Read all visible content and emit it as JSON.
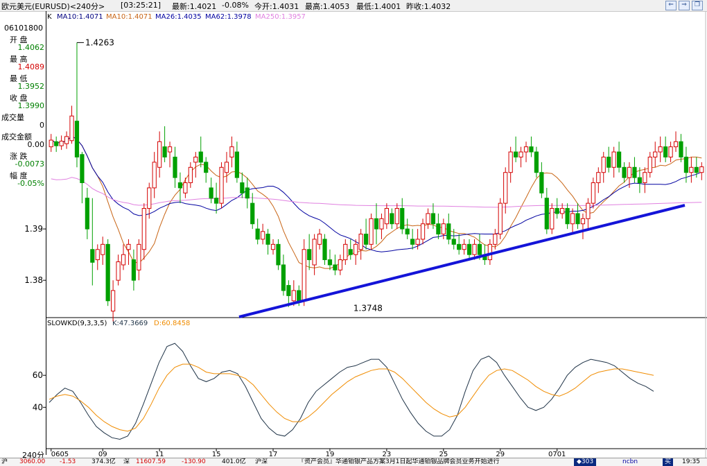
{
  "window": {
    "title": "欧元美元(EURUSD)<240分>",
    "time": "[03:25:21]",
    "latest": "最新:1.4021",
    "change_pct": "-0.08%",
    "open_today": "今开:1.4031",
    "high": "最高:1.4053",
    "low": "最低:1.4001",
    "prev_close": "昨收:1.4032"
  },
  "side_panel": {
    "date": "06101800",
    "open_label": "开  盘",
    "open_value": "1.4062",
    "high_label": "最  高",
    "high_value": "1.4089",
    "low_label": "最  低",
    "low_value": "1.3952",
    "close_label": "收  盘",
    "close_value": "1.3990",
    "volume_label": "成交量",
    "volume_value": "0",
    "amount_label": "成交金额",
    "amount_value": "0.00",
    "change_label": "涨  跌",
    "change_value": "-0.0073",
    "range_label": "幅  度",
    "range_value": "-0.05%",
    "period_label": "240分"
  },
  "colors": {
    "up": "#d40000",
    "down": "#00a000",
    "ma10": "#c86414",
    "ma26": "#0000a0",
    "ma250": "#e080e0",
    "trendline": "#1414d8",
    "k_line": "#1e3246",
    "d_line": "#f08c00",
    "label_text": "#000000",
    "value_text": "#008000",
    "high_text": "#d40000"
  },
  "legend": {
    "k": "K",
    "ma10a": "MA10:1.4071",
    "ma10b": "MA10:1.4071",
    "ma26": "MA26:1.4035",
    "ma62": "MA62:1.3978",
    "ma250": "MA250:1.3957",
    "slowkd": "SLOWKD(9,3,3,5)",
    "slowk": "K:47.3669",
    "slowd": "D:60.8458"
  },
  "chart_data": [
    {
      "type": "candlestick",
      "ylim": [
        1.373,
        1.43
      ],
      "y_ticks": [
        "1.39",
        "1.38"
      ],
      "y_tick_values": [
        1.39,
        1.38
      ],
      "annotations": [
        {
          "label": "1.4263",
          "x": 5,
          "value": 1.4263
        },
        {
          "label": "1.3748",
          "x": 65,
          "value": 1.3748
        }
      ],
      "candles": [
        [
          1.406,
          1.4085,
          1.405,
          1.4073
        ],
        [
          1.407,
          1.408,
          1.405,
          1.4062
        ],
        [
          1.4062,
          1.4082,
          1.4054,
          1.4071
        ],
        [
          1.4066,
          1.409,
          1.4056,
          1.408
        ],
        [
          1.4072,
          1.414,
          1.4066,
          1.412
        ],
        [
          1.411,
          1.4263,
          1.402,
          1.404
        ],
        [
          1.4045,
          1.405,
          1.395,
          1.399
        ],
        [
          1.396,
          1.398,
          1.388,
          1.39
        ],
        [
          1.386,
          1.396,
          1.379,
          1.3835
        ],
        [
          1.384,
          1.387,
          1.382,
          1.386
        ],
        [
          1.385,
          1.3885,
          1.383,
          1.387
        ],
        [
          1.387,
          1.388,
          1.375,
          1.376
        ],
        [
          1.374,
          1.38,
          1.372,
          1.378
        ],
        [
          1.38,
          1.385,
          1.379,
          1.3836
        ],
        [
          1.383,
          1.387,
          1.382,
          1.385
        ],
        [
          1.386,
          1.388,
          1.383,
          1.387
        ],
        [
          1.384,
          1.386,
          1.378,
          1.38
        ],
        [
          1.382,
          1.388,
          1.38,
          1.387
        ],
        [
          1.386,
          1.395,
          1.384,
          1.394
        ],
        [
          1.394,
          1.399,
          1.392,
          1.398
        ],
        [
          1.398,
          1.405,
          1.396,
          1.403
        ],
        [
          1.402,
          1.409,
          1.4,
          1.407
        ],
        [
          1.406,
          1.41,
          1.403,
          1.404
        ],
        [
          1.405,
          1.407,
          1.402,
          1.406
        ],
        [
          1.404,
          1.406,
          1.398,
          1.4
        ],
        [
          1.399,
          1.401,
          1.395,
          1.398
        ],
        [
          1.397,
          1.4,
          1.396,
          1.399
        ],
        [
          1.399,
          1.403,
          1.398,
          1.402
        ],
        [
          1.403,
          1.405,
          1.4,
          1.404
        ],
        [
          1.405,
          1.408,
          1.402,
          1.403
        ],
        [
          1.403,
          1.404,
          1.399,
          1.401
        ],
        [
          1.398,
          1.4,
          1.395,
          1.396
        ],
        [
          1.396,
          1.399,
          1.393,
          1.395
        ],
        [
          1.395,
          1.403,
          1.394,
          1.402
        ],
        [
          1.401,
          1.405,
          1.399,
          1.403
        ],
        [
          1.404,
          1.408,
          1.402,
          1.406
        ],
        [
          1.405,
          1.407,
          1.399,
          1.4
        ],
        [
          1.399,
          1.401,
          1.396,
          1.397
        ],
        [
          1.398,
          1.4,
          1.394,
          1.396
        ],
        [
          1.395,
          1.397,
          1.39,
          1.391
        ],
        [
          1.39,
          1.392,
          1.387,
          1.388
        ],
        [
          1.388,
          1.391,
          1.387,
          1.3895
        ],
        [
          1.389,
          1.39,
          1.385,
          1.387
        ],
        [
          1.386,
          1.388,
          1.385,
          1.387
        ],
        [
          1.387,
          1.388,
          1.382,
          1.383
        ],
        [
          1.383,
          1.385,
          1.377,
          1.378
        ],
        [
          1.379,
          1.38,
          1.3748,
          1.377
        ],
        [
          1.376,
          1.38,
          1.375,
          1.378
        ],
        [
          1.378,
          1.379,
          1.375,
          1.376
        ],
        [
          1.376,
          1.388,
          1.375,
          1.386
        ],
        [
          1.386,
          1.389,
          1.382,
          1.384
        ],
        [
          1.383,
          1.389,
          1.381,
          1.388
        ],
        [
          1.387,
          1.39,
          1.386,
          1.389
        ],
        [
          1.388,
          1.389,
          1.383,
          1.384
        ],
        [
          1.384,
          1.386,
          1.382,
          1.383
        ],
        [
          1.383,
          1.385,
          1.381,
          1.382
        ],
        [
          1.382,
          1.385,
          1.381,
          1.384
        ],
        [
          1.384,
          1.388,
          1.383,
          1.387
        ],
        [
          1.386,
          1.388,
          1.384,
          1.385
        ],
        [
          1.385,
          1.388,
          1.383,
          1.387
        ],
        [
          1.386,
          1.39,
          1.384,
          1.389
        ],
        [
          1.389,
          1.392,
          1.386,
          1.387
        ],
        [
          1.387,
          1.393,
          1.386,
          1.392
        ],
        [
          1.392,
          1.395,
          1.387,
          1.39
        ],
        [
          1.39,
          1.393,
          1.388,
          1.392
        ],
        [
          1.391,
          1.395,
          1.39,
          1.394
        ],
        [
          1.393,
          1.394,
          1.39,
          1.391
        ],
        [
          1.391,
          1.395,
          1.39,
          1.394
        ],
        [
          1.394,
          1.396,
          1.389,
          1.39
        ],
        [
          1.39,
          1.392,
          1.388,
          1.389
        ],
        [
          1.388,
          1.39,
          1.386,
          1.387
        ],
        [
          1.387,
          1.39,
          1.386,
          1.388
        ],
        [
          1.388,
          1.392,
          1.387,
          1.391
        ],
        [
          1.391,
          1.394,
          1.39,
          1.393
        ],
        [
          1.393,
          1.395,
          1.39,
          1.391
        ],
        [
          1.391,
          1.393,
          1.388,
          1.389
        ],
        [
          1.389,
          1.392,
          1.388,
          1.391
        ],
        [
          1.391,
          1.393,
          1.387,
          1.388
        ],
        [
          1.388,
          1.39,
          1.386,
          1.387
        ],
        [
          1.387,
          1.389,
          1.385,
          1.386
        ],
        [
          1.386,
          1.388,
          1.385,
          1.387
        ],
        [
          1.387,
          1.388,
          1.384,
          1.385
        ],
        [
          1.385,
          1.388,
          1.384,
          1.387
        ],
        [
          1.387,
          1.389,
          1.384,
          1.385
        ],
        [
          1.385,
          1.387,
          1.383,
          1.384
        ],
        [
          1.384,
          1.388,
          1.383,
          1.387
        ],
        [
          1.387,
          1.39,
          1.386,
          1.389
        ],
        [
          1.389,
          1.396,
          1.388,
          1.395
        ],
        [
          1.395,
          1.402,
          1.393,
          1.401
        ],
        [
          1.401,
          1.406,
          1.399,
          1.405
        ],
        [
          1.405,
          1.408,
          1.403,
          1.404
        ],
        [
          1.404,
          1.406,
          1.402,
          1.405
        ],
        [
          1.405,
          1.407,
          1.403,
          1.406
        ],
        [
          1.406,
          1.408,
          1.404,
          1.405
        ],
        [
          1.405,
          1.406,
          1.4,
          1.401
        ],
        [
          1.401,
          1.403,
          1.396,
          1.397
        ],
        [
          1.396,
          1.398,
          1.389,
          1.39
        ],
        [
          1.39,
          1.395,
          1.389,
          1.394
        ],
        [
          1.394,
          1.396,
          1.392,
          1.393
        ],
        [
          1.393,
          1.395,
          1.392,
          1.394
        ],
        [
          1.394,
          1.395,
          1.39,
          1.391
        ],
        [
          1.391,
          1.394,
          1.389,
          1.393
        ],
        [
          1.393,
          1.395,
          1.39,
          1.391
        ],
        [
          1.391,
          1.393,
          1.388,
          1.392
        ],
        [
          1.392,
          1.396,
          1.39,
          1.395
        ],
        [
          1.395,
          1.4,
          1.394,
          1.399
        ],
        [
          1.399,
          1.402,
          1.397,
          1.401
        ],
        [
          1.401,
          1.405,
          1.399,
          1.404
        ],
        [
          1.404,
          1.406,
          1.401,
          1.402
        ],
        [
          1.402,
          1.406,
          1.4,
          1.405
        ],
        [
          1.405,
          1.407,
          1.401,
          1.402
        ],
        [
          1.402,
          1.403,
          1.399,
          1.4
        ],
        [
          1.4,
          1.403,
          1.398,
          1.402
        ],
        [
          1.402,
          1.404,
          1.399,
          1.4
        ],
        [
          1.4,
          1.402,
          1.397,
          1.399
        ],
        [
          1.399,
          1.402,
          1.397,
          1.401
        ],
        [
          1.401,
          1.405,
          1.4,
          1.404
        ],
        [
          1.404,
          1.407,
          1.402,
          1.405
        ],
        [
          1.405,
          1.408,
          1.403,
          1.406
        ],
        [
          1.406,
          1.408,
          1.403,
          1.404
        ],
        [
          1.404,
          1.407,
          1.403,
          1.406
        ],
        [
          1.406,
          1.409,
          1.405,
          1.407
        ],
        [
          1.407,
          1.4085,
          1.403,
          1.404
        ],
        [
          1.404,
          1.406,
          1.399,
          1.401
        ],
        [
          1.401,
          1.404,
          1.399,
          1.402
        ],
        [
          1.402,
          1.404,
          1.4,
          1.401
        ],
        [
          1.401,
          1.403,
          1.3995,
          1.4021
        ]
      ]
    },
    {
      "type": "line",
      "name": "SLOWKD",
      "ylim": [
        15,
        90
      ],
      "y_ticks": [
        "60",
        "40"
      ],
      "y_tick_values": [
        60,
        40
      ],
      "x_ticks": [
        "0605",
        "09",
        "11",
        "15",
        "17",
        "19",
        "23",
        "25",
        "29",
        "0701"
      ],
      "x_tick_positions": [
        0,
        10,
        21,
        32,
        43,
        54,
        65,
        76,
        87,
        98
      ],
      "series": [
        {
          "name": "K",
          "values": [
            43,
            48,
            52,
            50,
            43,
            35,
            28,
            24,
            21,
            20,
            22,
            30,
            42,
            55,
            68,
            78,
            80,
            75,
            66,
            58,
            56,
            58,
            62,
            63,
            61,
            53,
            43,
            33,
            27,
            23,
            22,
            26,
            33,
            43,
            50,
            54,
            58,
            62,
            65,
            66,
            68,
            70,
            70,
            65,
            55,
            45,
            37,
            30,
            25,
            22,
            22,
            26,
            35,
            50,
            63,
            70,
            72,
            68,
            60,
            53,
            46,
            40,
            38,
            40,
            45,
            52,
            60,
            65,
            68,
            70,
            69,
            68,
            66,
            62,
            58,
            55,
            53,
            50
          ]
        },
        {
          "name": "D",
          "values": [
            45,
            47,
            48,
            47,
            44,
            40,
            35,
            31,
            28,
            26,
            25,
            27,
            33,
            42,
            52,
            60,
            65,
            67,
            67,
            65,
            62,
            61,
            61,
            61,
            60,
            58,
            54,
            48,
            42,
            37,
            33,
            31,
            31,
            34,
            38,
            43,
            48,
            52,
            56,
            59,
            61,
            63,
            64,
            64,
            62,
            58,
            53,
            48,
            43,
            39,
            36,
            34,
            35,
            40,
            47,
            54,
            60,
            63,
            64,
            63,
            60,
            57,
            53,
            50,
            48,
            47,
            49,
            52,
            56,
            60,
            62,
            63,
            64,
            64,
            63,
            62,
            61,
            60
          ]
        }
      ]
    }
  ],
  "status_bar": {
    "s1": "沪",
    "s2": "3060.00",
    "s3": "-1.53",
    "s4": "374.3亿",
    "s5": "深",
    "s6": "11607.59",
    "s7": "-130.90",
    "s8": "401.0亿",
    "s9": "沪深",
    "s10": "『资产会员』华通铂银产品方案3月1日起华通铂银品牌会员业务开始进行",
    "s11": "◆303",
    "s12": "ncbn",
    "s13": "买",
    "s14": "19:35"
  }
}
